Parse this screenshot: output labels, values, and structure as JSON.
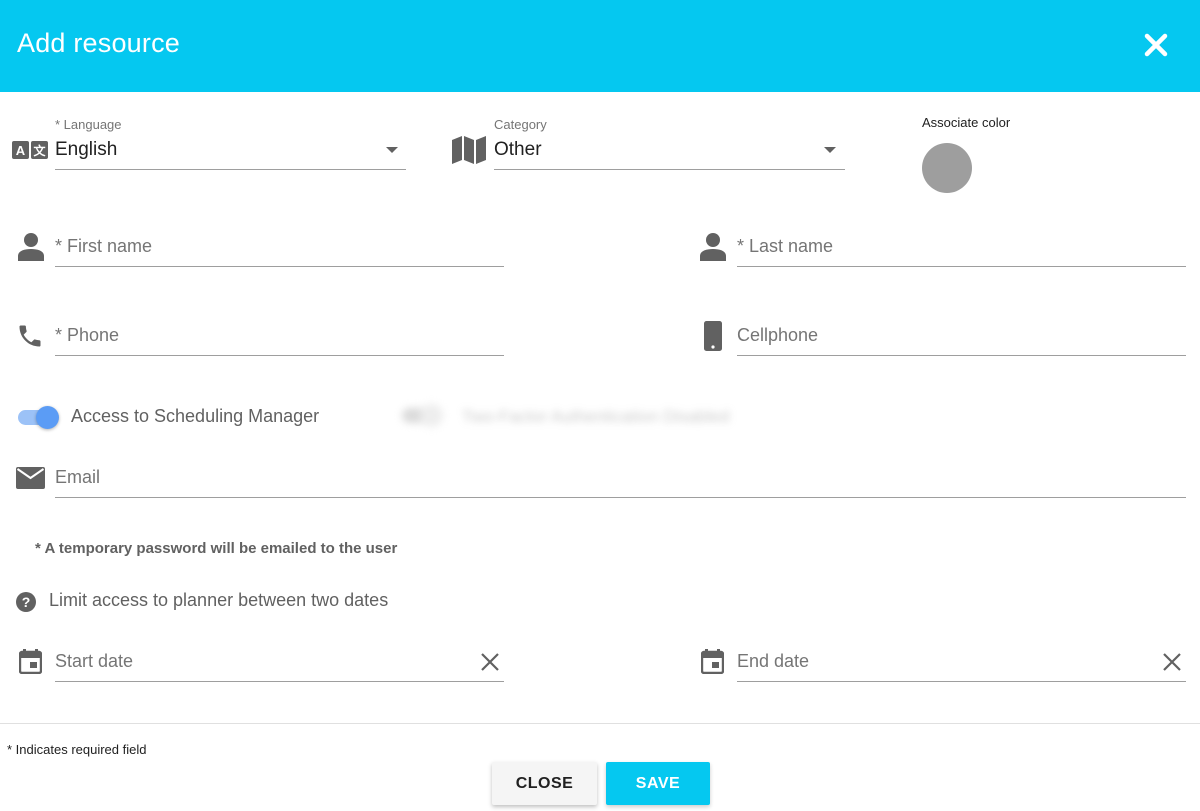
{
  "dialog": {
    "title": "Add resource"
  },
  "language": {
    "label": "* Language",
    "value": "English",
    "icon": "translate-icon"
  },
  "category": {
    "label": "Category",
    "value": "Other",
    "icon": "map-icon"
  },
  "color": {
    "label": "Associate color",
    "value": "#9e9e9e"
  },
  "first_name": {
    "placeholder": "* First name",
    "icon": "person-icon"
  },
  "last_name": {
    "placeholder": "* Last name",
    "icon": "person-icon"
  },
  "phone": {
    "placeholder": "* Phone",
    "icon": "phone-icon"
  },
  "cellphone": {
    "placeholder": "Cellphone",
    "icon": "smartphone-icon"
  },
  "scheduling_access": {
    "label": "Access to Scheduling Manager",
    "enabled": true
  },
  "two_factor": {
    "label": "Two-Factor Authentication Disabled",
    "enabled": false
  },
  "email": {
    "placeholder": "Email",
    "icon": "email-icon"
  },
  "password_note": "* A temporary password will be emailed to the user",
  "limit_access": {
    "label": "Limit access to planner between two dates",
    "icon": "help-icon"
  },
  "start_date": {
    "placeholder": "Start date",
    "icon": "calendar-icon"
  },
  "end_date": {
    "placeholder": "End date",
    "icon": "calendar-icon"
  },
  "footer": {
    "required_note": "* Indicates required field",
    "close_label": "CLOSE",
    "save_label": "SAVE"
  },
  "colors": {
    "header": "#05c8f0",
    "save_button": "#05c8f0",
    "toggle_on": "#5b9cf5"
  }
}
